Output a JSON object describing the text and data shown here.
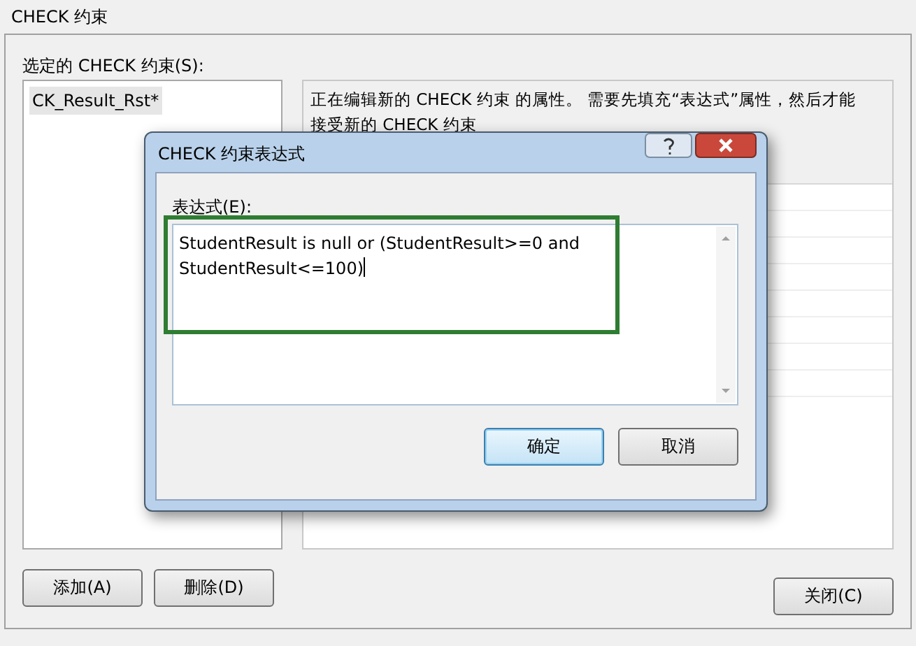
{
  "window": {
    "title": "CHECK 约束"
  },
  "constraints_label": "选定的 CHECK 约束(S):",
  "constraints": [
    {
      "name": "CK_Result_Rst*",
      "selected": true
    }
  ],
  "description_lines": [
    "正在编辑新的 CHECK 约束 的属性。 需要先填充“表达式”属性，然后才能",
    "接受新的 CHECK 约束"
  ],
  "left_buttons": [
    "添加(A)",
    "删除(D)"
  ],
  "close_button": "关闭(C)",
  "dialog": {
    "title": "CHECK 约束表达式",
    "label": "表达式(E):",
    "value": "StudentResult is null or (StudentResult>=0 and\nStudentResult<=100)",
    "highlighted": true,
    "buttons": [
      {
        "label": "确定",
        "default": true
      },
      {
        "label": "取消",
        "default": false
      }
    ]
  }
}
